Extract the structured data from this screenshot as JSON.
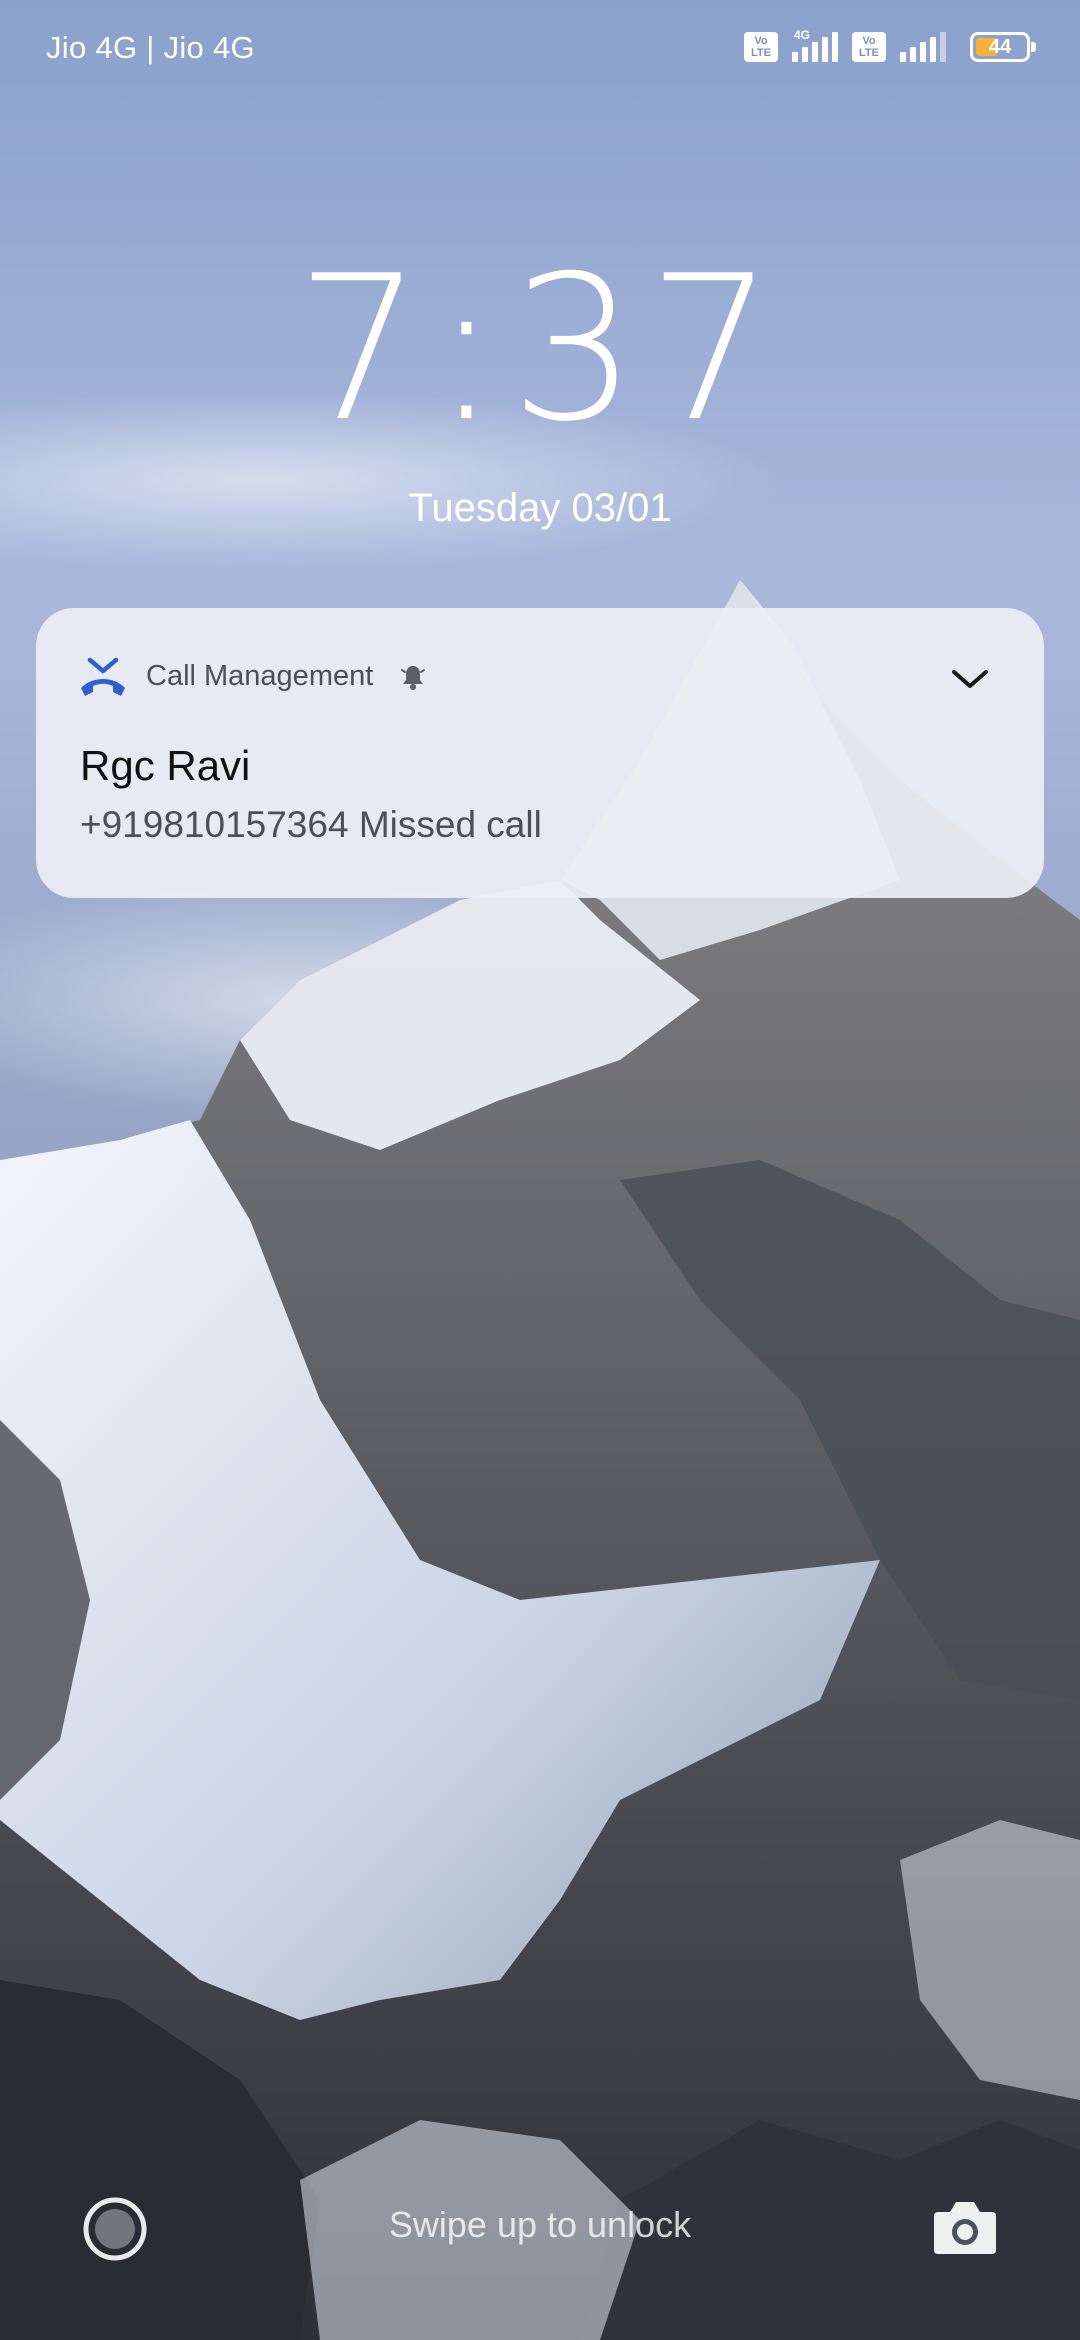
{
  "status_bar": {
    "carrier": "Jio 4G | Jio 4G",
    "sim1_badge_top": "Vo",
    "sim1_badge_bottom": "LTE",
    "sim1_network": "4G",
    "sim2_badge_top": "Vo",
    "sim2_badge_bottom": "LTE",
    "battery": "44",
    "battery_level": 0.44
  },
  "lockscreen": {
    "time": "7:37",
    "date": "Tuesday 03/01",
    "unlock_hint": "Swipe up to unlock"
  },
  "notification": {
    "app_name": "Call Management",
    "title": "Rgc Ravi",
    "body": "+919810157364 Missed call"
  },
  "icons": {
    "app": "missed-call-icon",
    "bell": "bell-icon",
    "expand": "chevron-down-icon",
    "left_shortcut": "circle-shortcut-icon",
    "camera": "camera-icon"
  },
  "colors": {
    "missed_call_icon": "#2f5fd0",
    "battery_fill": "#f5b23a"
  }
}
